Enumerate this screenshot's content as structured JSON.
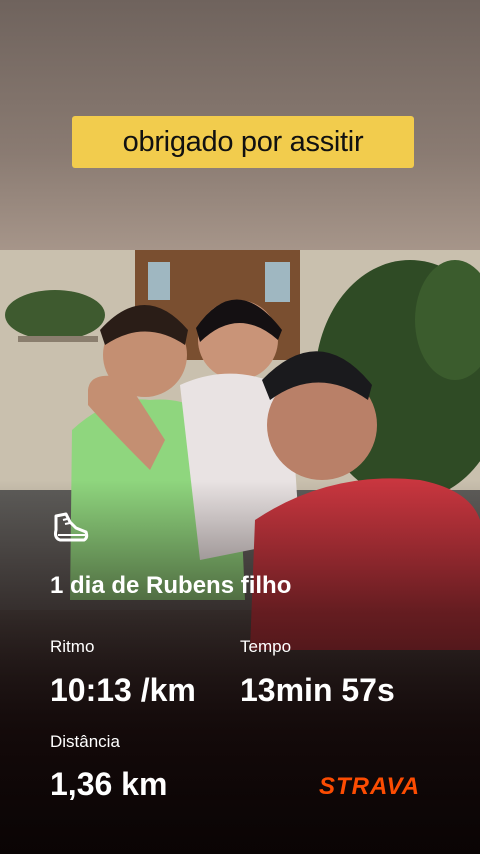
{
  "caption": {
    "text": "obrigado por assitir"
  },
  "activity": {
    "icon": "running-shoe-icon",
    "title": "1 dia de Rubens filho"
  },
  "stats": {
    "pace": {
      "label": "Ritmo",
      "value": "10:13 /km"
    },
    "time": {
      "label": "Tempo",
      "value": "13min 57s"
    },
    "distance": {
      "label": "Distância",
      "value": "1,36 km"
    }
  },
  "brand": {
    "name": "STRAVA",
    "color": "#fc4c02"
  },
  "colors": {
    "caption_bg": "#f2cc4d",
    "text": "#ffffff"
  }
}
